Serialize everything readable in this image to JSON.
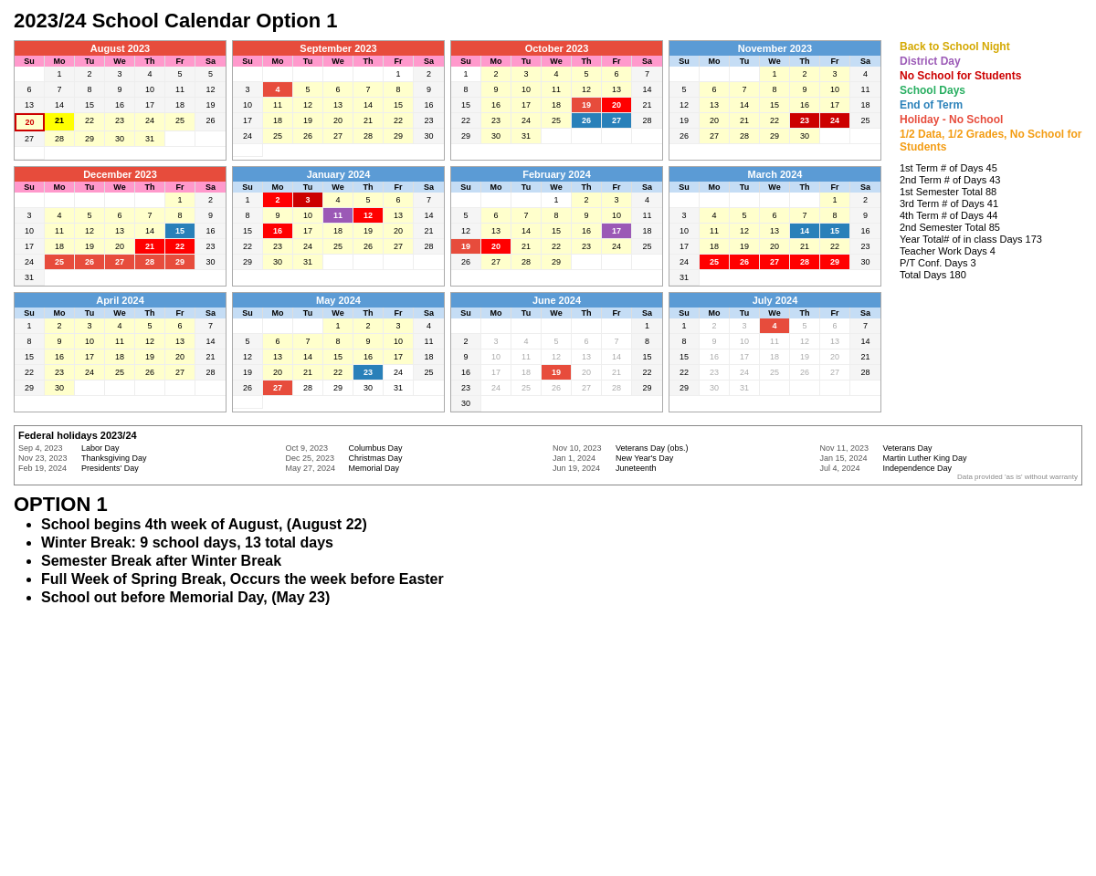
{
  "title": "2023/24 School Calendar Option 1",
  "legend": [
    {
      "id": "back-to-school",
      "label": "Back to School Night",
      "color": "yellow"
    },
    {
      "id": "district-day",
      "label": "District Day",
      "color": "purple"
    },
    {
      "id": "no-school-students",
      "label": "No School for Students",
      "color": "red-bold"
    },
    {
      "id": "school-days",
      "label": "School Days",
      "color": "green"
    },
    {
      "id": "end-of-term",
      "label": "End of Term",
      "color": "blue"
    },
    {
      "id": "holiday-no-school",
      "label": "Holiday - No School",
      "color": "red-holiday"
    },
    {
      "id": "half-data",
      "label": "1/2 Data, 1/2 Grades, No School for Students",
      "color": "orange"
    }
  ],
  "stats": [
    "1st Term # of Days 45",
    "2nd Term # of Days 43",
    "1st Semester Total 88",
    "3rd Term # of Days 41",
    "4th Term # of Days 44",
    "2nd Semester Total 85",
    "Year Total# of in class Days 173",
    "Teacher Work Days 4",
    "P/T Conf. Days 3",
    "Total Days 180"
  ],
  "federal_holidays_title": "Federal holidays 2023/24",
  "federal_holidays": [
    {
      "date": "Sep 4, 2023",
      "name": "Labor Day"
    },
    {
      "date": "Oct 9, 2023",
      "name": "Columbus Day"
    },
    {
      "date": "Nov 10, 2023",
      "name": "Veterans Day (obs.)"
    },
    {
      "date": "Nov 11, 2023",
      "name": "Veterans Day"
    },
    {
      "date": "Nov 23, 2023",
      "name": "Thanksgiving Day"
    },
    {
      "date": "Dec 25, 2023",
      "name": "Christmas Day"
    },
    {
      "date": "Jan 1, 2024",
      "name": "New Year's Day"
    },
    {
      "date": "Jan 15, 2024",
      "name": "Martin Luther King Day"
    },
    {
      "date": "Feb 19, 2024",
      "name": "Presidents' Day"
    },
    {
      "date": "May 27, 2024",
      "name": "Memorial Day"
    },
    {
      "date": "Jun 19, 2024",
      "name": "Juneteenth"
    },
    {
      "date": "Jul 4, 2024",
      "name": "Independence Day"
    }
  ],
  "data_note": "Data provided 'as is' without warranty",
  "option_title": "OPTION 1",
  "option_bullets": [
    "School begins 4th week of August, (August 22)",
    "Winter Break: 9 school days, 13 total days",
    "Semester Break after Winter Break",
    "Full Week of Spring Break, Occurs the week before Easter",
    "School out before Memorial Day, (May 23)"
  ]
}
